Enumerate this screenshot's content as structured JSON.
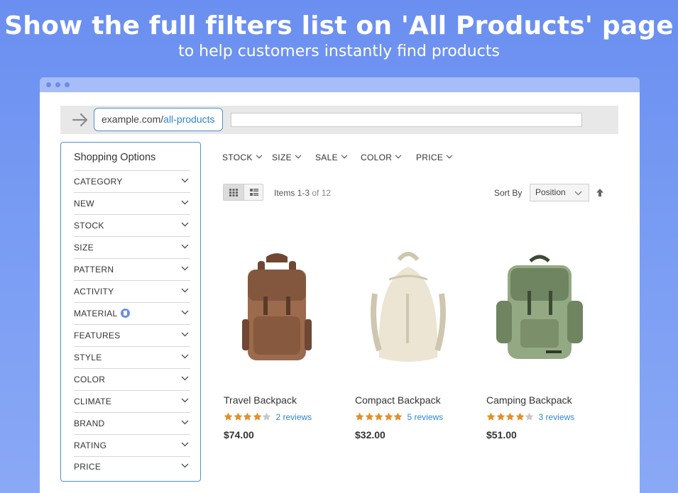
{
  "banner": {
    "headline": "Show the full filters list on 'All Products' page",
    "subline": "to help customers instantly find products"
  },
  "address": {
    "domain": "example.com/",
    "path": "all-products"
  },
  "sidebar": {
    "title": "Shopping Options",
    "filters": [
      {
        "label": "CATEGORY"
      },
      {
        "label": "NEW"
      },
      {
        "label": "STOCK"
      },
      {
        "label": "SIZE"
      },
      {
        "label": "PATTERN"
      },
      {
        "label": "ACTIVITY"
      },
      {
        "label": "MATERIAL",
        "info_icon": true
      },
      {
        "label": "FEATURES"
      },
      {
        "label": "STYLE"
      },
      {
        "label": "COLOR"
      },
      {
        "label": "CLIMATE"
      },
      {
        "label": "BRAND"
      },
      {
        "label": "RATING"
      },
      {
        "label": "PRICE"
      }
    ]
  },
  "top_filters": [
    "STOCK",
    "SIZE",
    "SALE",
    "COLOR",
    "PRICE"
  ],
  "toolbar": {
    "items_range": "Items 1-3",
    "items_total": "of 12",
    "sort_label": "Sort By",
    "sort_value": "Position"
  },
  "products": [
    {
      "name": "Travel Backpack",
      "rating": 4,
      "reviews": "2 reviews",
      "price": "$74.00",
      "color": "#9c6a4c",
      "color_dark": "#6f4733"
    },
    {
      "name": "Compact Backpack",
      "rating": 5,
      "reviews": "5 reviews",
      "price": "$32.00",
      "color": "#ece5d3",
      "color_dark": "#cfc6b0"
    },
    {
      "name": "Camping Backpack",
      "rating": 4,
      "reviews": "3 reviews",
      "price": "$51.00",
      "color": "#93a983",
      "color_dark": "#6f8460"
    }
  ],
  "colors": {
    "accent": "#4c8fd6",
    "link": "#2f86d1",
    "star": "#e0902c",
    "star_empty": "#c8c8c8",
    "banner": "#6a8ff0"
  }
}
